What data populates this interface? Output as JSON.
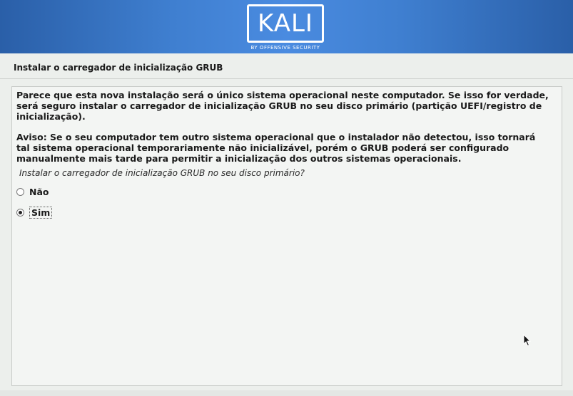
{
  "header": {
    "logo_text": "KALI",
    "logo_subtitle": "BY OFFENSIVE SECURITY"
  },
  "step": {
    "title": "Instalar o carregador de inicialização GRUB"
  },
  "content": {
    "message1": "Parece que esta nova instalação será o único sistema operacional neste computador. Se isso for verdade, será seguro instalar o carregador de inicialização GRUB no seu disco primário (partição UEFI/registro de inicialização).",
    "message2": "Aviso: Se o seu computador tem outro sistema operacional que o instalador não detectou, isso tornará tal sistema operacional temporariamente não inicializável, porém o GRUB poderá ser configurado manualmente mais tarde para permitir a inicialização dos outros sistemas operacionais.",
    "question": "Instalar o carregador de inicialização GRUB no seu disco primário?",
    "options": [
      {
        "label": "Não",
        "selected": false
      },
      {
        "label": "Sim",
        "selected": true
      }
    ]
  },
  "colors": {
    "banner": "#3f7fd0",
    "background": "#ecefec"
  }
}
